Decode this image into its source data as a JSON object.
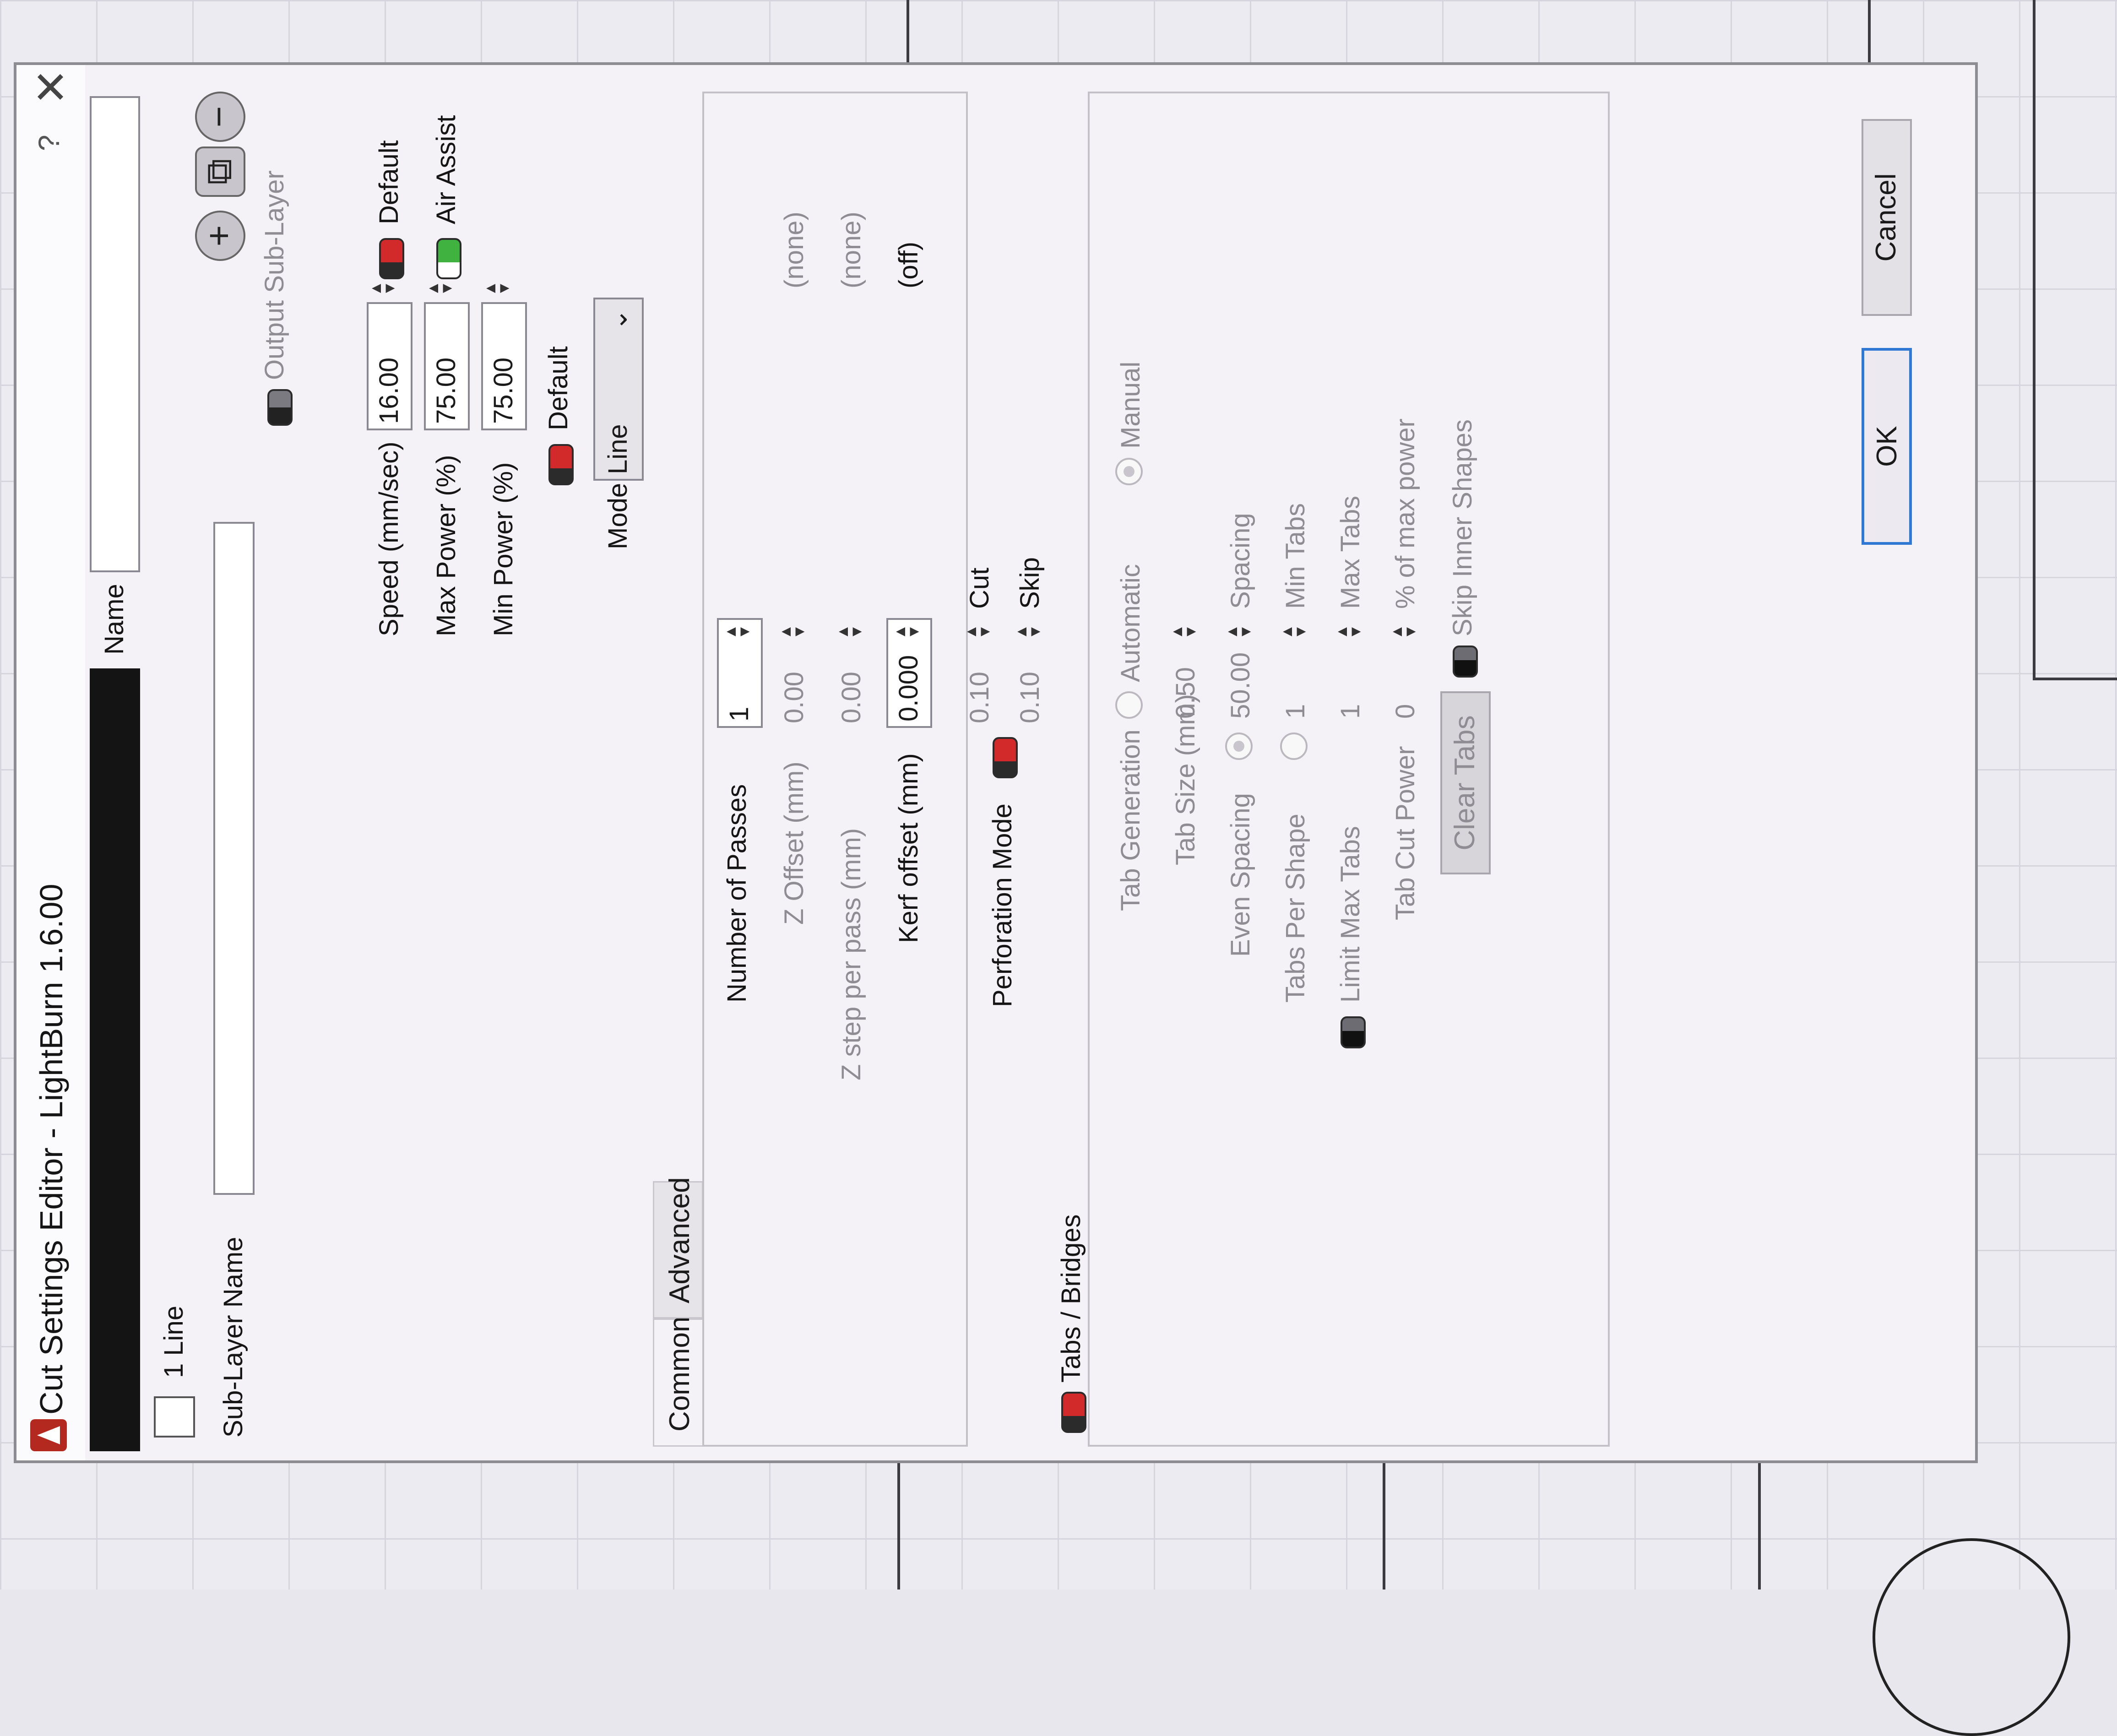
{
  "window": {
    "title": "Cut Settings Editor - LightBurn 1.6.00",
    "help_label": "?",
    "close_label": "✕"
  },
  "layer": {
    "checkbox_label": "1 Line",
    "name_label": "Name",
    "name_value": "",
    "sublayer_name_label": "Sub-Layer Name",
    "sublayer_name_value": "",
    "output_sublayer_label": "Output Sub-Layer",
    "swatch_color": "#141414"
  },
  "tabs": [
    {
      "label": "Common"
    },
    {
      "label": "Advanced"
    }
  ],
  "common": {
    "speed_label": "Speed (mm/sec)",
    "speed_value": "16.00",
    "speed_default_label": "Default",
    "max_power_label": "Max Power (%)",
    "max_power_value": "75.00",
    "air_assist_label": "Air Assist",
    "min_power_label": "Min Power (%)",
    "min_power_value": "75.00",
    "default_label": "Default",
    "mode_label": "Mode",
    "mode_value": "Line",
    "passes_label": "Number of Passes",
    "passes_value": "1",
    "z_offset_label": "Z Offset (mm)",
    "z_offset_value": "0.00",
    "z_offset_note": "(none)",
    "z_step_label": "Z step per pass (mm)",
    "z_step_value": "0.00",
    "z_step_note": "(none)",
    "kerf_label": "Kerf offset (mm)",
    "kerf_value": "0.000",
    "kerf_note": "(off)",
    "perforation_label": "Perforation Mode",
    "perf_cut_value": "0.10",
    "perf_cut_label": "Cut",
    "perf_skip_value": "0.10",
    "perf_skip_label": "Skip"
  },
  "tabs_bridges": {
    "section_label": "Tabs / Bridges",
    "tab_generation_label": "Tab Generation",
    "automatic_label": "Automatic",
    "manual_label": "Manual",
    "tab_size_label": "Tab Size (mm)",
    "tab_size_value": "0.50",
    "even_spacing_label": "Even Spacing",
    "even_spacing_value": "50.00",
    "spacing_label": "Spacing",
    "tabs_per_shape_label": "Tabs Per Shape",
    "tabs_per_shape_value": "1",
    "min_tabs_label": "Min Tabs",
    "limit_max_tabs_label": "Limit Max Tabs",
    "limit_max_tabs_value": "1",
    "max_tabs_label": "Max Tabs",
    "tab_cut_power_label": "Tab Cut Power",
    "tab_cut_power_value": "0",
    "percent_max_power_label": "% of max power",
    "skip_inner_label": "Skip Inner Shapes",
    "clear_tabs_label": "Clear Tabs"
  },
  "footer": {
    "ok_label": "OK",
    "cancel_label": "Cancel"
  },
  "icons": [
    "app-logo-icon",
    "plus-icon",
    "copy-icon",
    "minus-icon",
    "close-icon",
    "chevron-down-icon"
  ]
}
